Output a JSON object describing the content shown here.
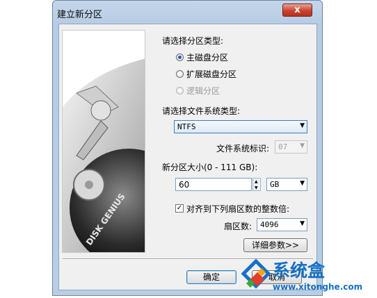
{
  "window": {
    "title": "建立新分区",
    "close_glyph": "x"
  },
  "image": {
    "brand_text": "DISK GENIUS"
  },
  "partition_type": {
    "heading": "请选择分区类型:",
    "options": [
      {
        "label": "主磁盘分区",
        "selected": true,
        "enabled": true
      },
      {
        "label": "扩展磁盘分区",
        "selected": false,
        "enabled": true
      },
      {
        "label": "逻辑分区",
        "selected": false,
        "enabled": false
      }
    ]
  },
  "filesystem": {
    "heading": "请选择文件系统类型:",
    "selected": "NTFS",
    "id_label": "文件系统标识:",
    "id_value": "07"
  },
  "size": {
    "label": "新分区大小(0 - 111 GB):",
    "value": "60",
    "unit": "GB"
  },
  "align": {
    "label": "对齐到下列扇区数的整数倍:",
    "checked": true,
    "check_glyph": "✓",
    "sectors_label": "扇区数:",
    "sectors_value": "4096"
  },
  "buttons": {
    "details": "详细参数>>",
    "ok": "确定",
    "cancel": "取消"
  },
  "watermark": {
    "brand": "系统盒",
    "url": "www.xitonghe.com"
  },
  "colors": {
    "accent": "#1b5fb7",
    "titlebar": "#b9cde5",
    "watermark_blue": "#1570c4"
  }
}
